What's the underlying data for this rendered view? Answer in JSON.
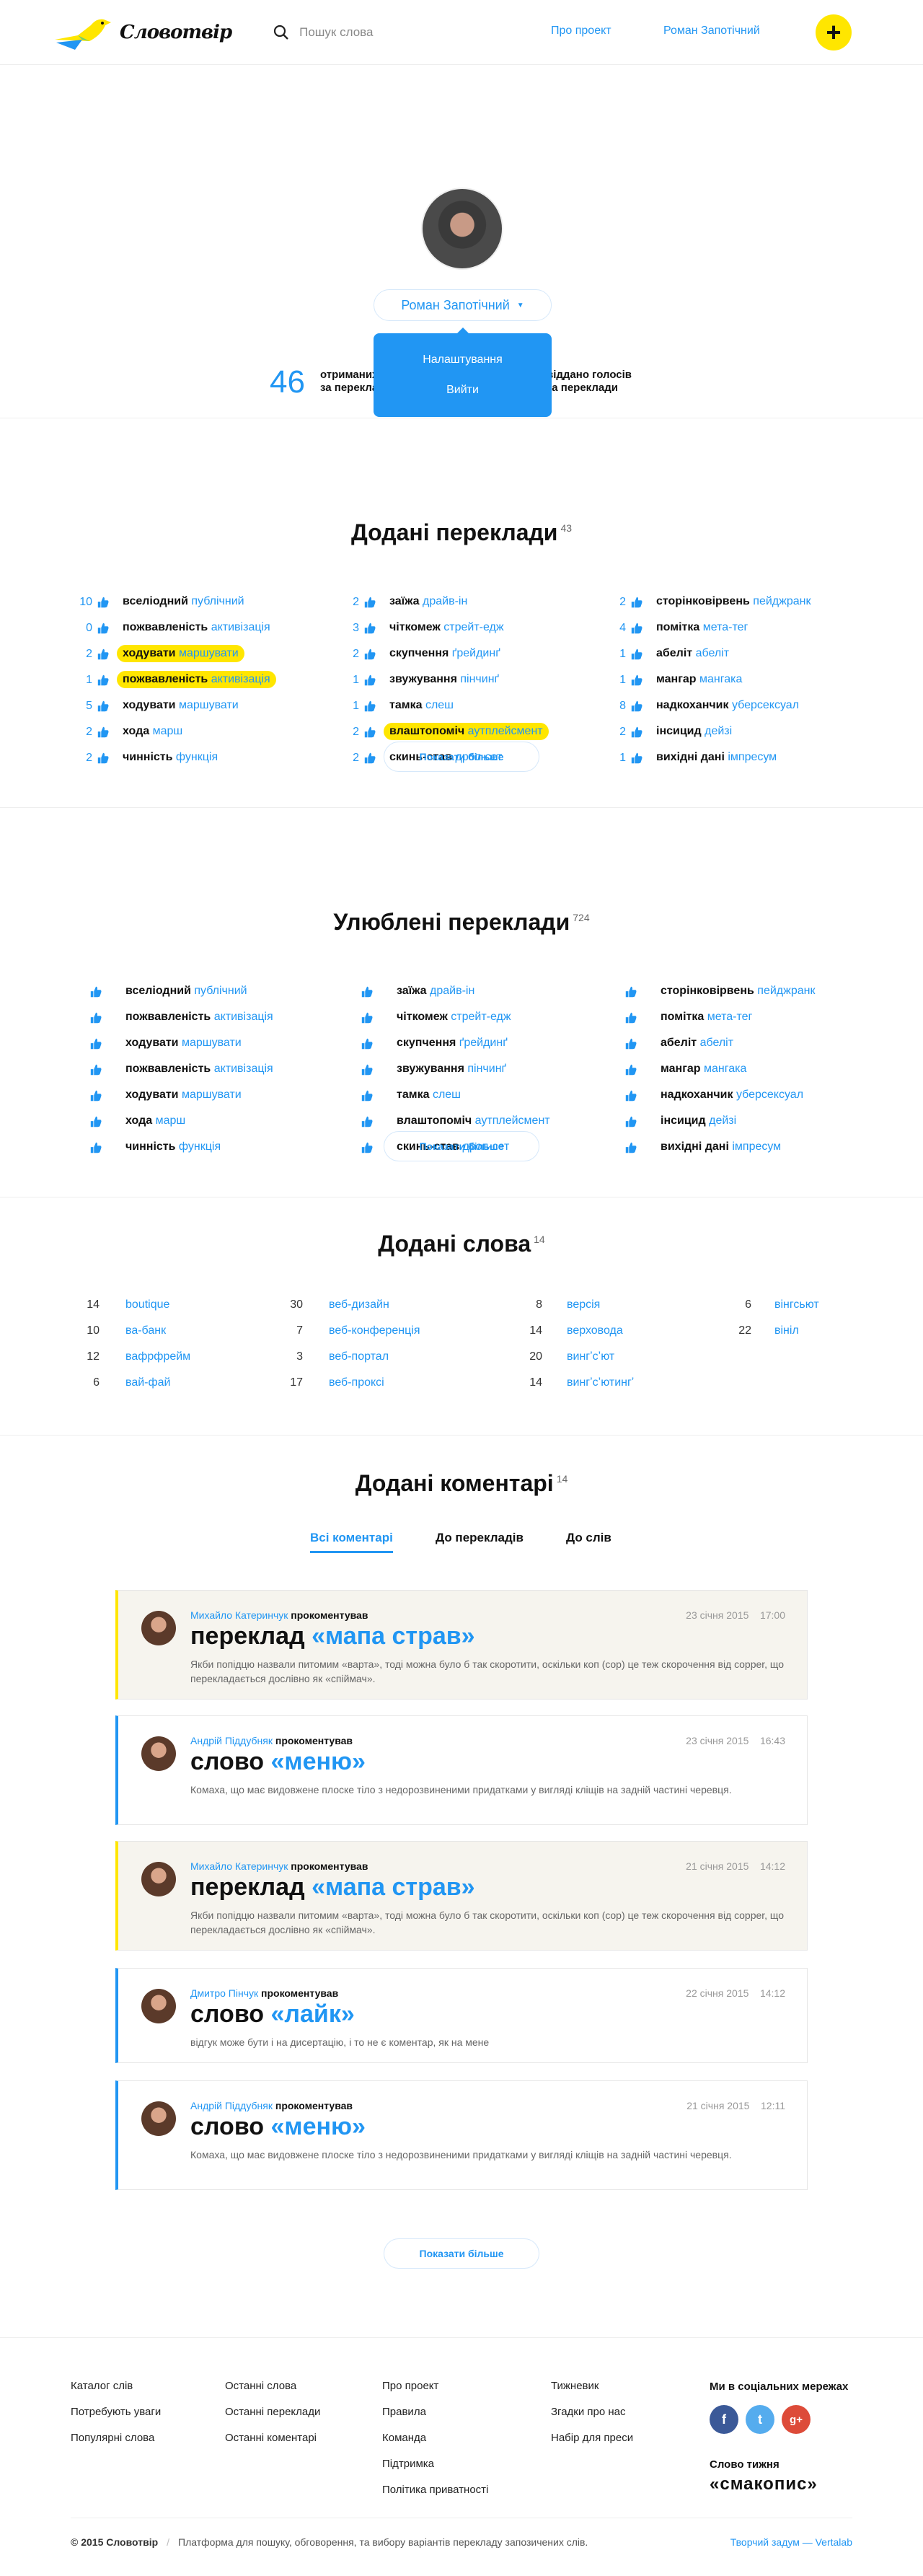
{
  "header": {
    "logo_text": "Словотвір",
    "search_placeholder": "Пошук слова",
    "nav": [
      "Про проект",
      "Роман Запотічний"
    ],
    "add_label": "+"
  },
  "profile": {
    "user_label": "Роман Запотічний",
    "menu": [
      "Налаштування",
      "Вийти"
    ],
    "stat1_num": "46",
    "stat1_lbl1": "отриманих голосів",
    "stat1_lbl2": "за переклади",
    "stat2_lbl1": "віддано голосів",
    "stat2_lbl2": "за переклади"
  },
  "added_translations": {
    "title": "Додані переклади",
    "count": "43",
    "more": "Показати більше",
    "cols": [
      [
        {
          "n": "10",
          "w": "вселіодний",
          "t": "публічний",
          "hl": false
        },
        {
          "n": "0",
          "w": "пожвавленість",
          "t": "активізація",
          "hl": false
        },
        {
          "n": "2",
          "w": "ходувати",
          "t": "маршувати",
          "hl": true
        },
        {
          "n": "1",
          "w": "пожвавленість",
          "t": "активізація",
          "hl": true
        },
        {
          "n": "5",
          "w": "ходувати",
          "t": "маршувати",
          "hl": false
        },
        {
          "n": "2",
          "w": "хода",
          "t": "марш",
          "hl": false
        },
        {
          "n": "2",
          "w": "чинність",
          "t": "функція",
          "hl": false
        }
      ],
      [
        {
          "n": "2",
          "w": "заїжа",
          "t": "драйв-ін",
          "hl": false
        },
        {
          "n": "3",
          "w": "чіткомеж",
          "t": "стрейт-едж",
          "hl": false
        },
        {
          "n": "2",
          "w": "скупчення",
          "t": "ґрейдинґ",
          "hl": false
        },
        {
          "n": "1",
          "w": "звужування",
          "t": "пінчинґ",
          "hl": false
        },
        {
          "n": "1",
          "w": "тамка",
          "t": "слеш",
          "hl": false
        },
        {
          "n": "2",
          "w": "влаштопоміч",
          "t": "аутплейсмент",
          "hl": true
        },
        {
          "n": "2",
          "w": "скинь-став",
          "t": "дроп-сет",
          "hl": false
        }
      ],
      [
        {
          "n": "2",
          "w": "сторінковірвень",
          "t": "пейджранк",
          "hl": false
        },
        {
          "n": "4",
          "w": "помітка",
          "t": "мета-тег",
          "hl": false
        },
        {
          "n": "1",
          "w": "абеліт",
          "t": "абеліт",
          "hl": false
        },
        {
          "n": "1",
          "w": "мангар",
          "t": "мангака",
          "hl": false
        },
        {
          "n": "8",
          "w": "надкоханчик",
          "t": "уберсексуал",
          "hl": false
        },
        {
          "n": "2",
          "w": "інсицид",
          "t": "дейзі",
          "hl": false
        },
        {
          "n": "1",
          "w": "вихідні дані",
          "t": "імпресум",
          "hl": false
        }
      ]
    ]
  },
  "favorite_translations": {
    "title": "Улюблені переклади",
    "count": "724",
    "more": "Показати більше",
    "cols": [
      [
        {
          "w": "вселіодний",
          "t": "публічний"
        },
        {
          "w": "пожвавленість",
          "t": "активізація"
        },
        {
          "w": "ходувати",
          "t": "маршувати"
        },
        {
          "w": "пожвавленість",
          "t": "активізація"
        },
        {
          "w": "ходувати",
          "t": "маршувати"
        },
        {
          "w": "хода",
          "t": "марш"
        },
        {
          "w": "чинність",
          "t": "функція"
        }
      ],
      [
        {
          "w": "заїжа",
          "t": "драйв-ін"
        },
        {
          "w": "чіткомеж",
          "t": "стрейт-едж"
        },
        {
          "w": "скупчення",
          "t": "ґрейдинґ"
        },
        {
          "w": "звужування",
          "t": "пінчинґ"
        },
        {
          "w": "тамка",
          "t": "слеш"
        },
        {
          "w": "влаштопоміч",
          "t": "аутплейсмент"
        },
        {
          "w": "скинь-став",
          "t": "дроп-сет"
        }
      ],
      [
        {
          "w": "сторінковірвень",
          "t": "пейджранк"
        },
        {
          "w": "помітка",
          "t": "мета-тег"
        },
        {
          "w": "абеліт",
          "t": "абеліт"
        },
        {
          "w": "мангар",
          "t": "мангака"
        },
        {
          "w": "надкоханчик",
          "t": "уберсексуал"
        },
        {
          "w": "інсицид",
          "t": "дейзі"
        },
        {
          "w": "вихідні дані",
          "t": "імпресум"
        }
      ]
    ]
  },
  "added_words": {
    "title": "Додані слова",
    "count": "14",
    "cols": [
      [
        {
          "n": "14",
          "w": "boutique"
        },
        {
          "n": "10",
          "w": "ва-банк"
        },
        {
          "n": "12",
          "w": "вафрфрейм"
        },
        {
          "n": "6",
          "w": "вай-фай"
        }
      ],
      [
        {
          "n": "30",
          "w": "веб-дизайн"
        },
        {
          "n": "7",
          "w": "веб-конференція"
        },
        {
          "n": "3",
          "w": "веб-портал"
        },
        {
          "n": "17",
          "w": "веб-проксі"
        }
      ],
      [
        {
          "n": "8",
          "w": "версія"
        },
        {
          "n": "14",
          "w": "верховода"
        },
        {
          "n": "20",
          "w": "вингʼсʼют"
        },
        {
          "n": "14",
          "w": "вингʼсʼютингʼ"
        }
      ],
      [
        {
          "n": "6",
          "w": "вінгсьют"
        },
        {
          "n": "22",
          "w": "вініл"
        }
      ]
    ]
  },
  "comments": {
    "title": "Додані коментарі",
    "count": "14",
    "tabs": [
      "Всі коментарі",
      "До перекладів",
      "До слів"
    ],
    "more": "Показати більше",
    "items": [
      {
        "author": "Михайло Катеринчук",
        "action": "прокоментував",
        "date": "23 січня 2015",
        "time": "17:00",
        "prefix": "переклад",
        "quote": "«мапа страв»",
        "text": "Якби попідцю назвали питомим «варта», тоді можна було б так скоротити, оскільки коп (cop) це теж скорочення від copper, що перекладається дослівно як «спіймач»."
      },
      {
        "author": "Андрій Піддубняк",
        "action": "прокоментував",
        "date": "23 січня 2015",
        "time": "16:43",
        "prefix": "слово",
        "quote": "«меню»",
        "text": "Комаха, що має видовжене плоске тіло з недорозвиненими придатками у вигляді кліщів на задній частині черевця."
      },
      {
        "author": "Михайло Катеринчук",
        "action": "прокоментував",
        "date": "21 січня 2015",
        "time": "14:12",
        "prefix": "переклад",
        "quote": "«мапа страв»",
        "text": "Якби попідцю назвали питомим «варта», тоді можна було б так скоротити, оскільки коп (cop) це теж скорочення від copper, що перекладається дослівно як «спіймач»."
      },
      {
        "author": "Дмитро Пінчук",
        "action": "прокоментував",
        "date": "22 січня 2015",
        "time": "14:12",
        "prefix": "слово",
        "quote": "«лайк»",
        "text": "відгук може бути і на дисертацію, і то не є коментар, як на мене"
      },
      {
        "author": "Андрій Піддубняк",
        "action": "прокоментував",
        "date": "21 січня 2015",
        "time": "12:11",
        "prefix": "слово",
        "quote": "«меню»",
        "text": "Комаха, що має видовжене плоске тіло з недорозвиненими придатками у вигляді кліщів на задній частині черевця."
      }
    ]
  },
  "footer": {
    "col1": [
      "Каталог слів",
      "Потребують уваги",
      "Популярні слова"
    ],
    "col2": [
      "Останні слова",
      "Останні переклади",
      "Останні коментарі"
    ],
    "col3": [
      "Про проект",
      "Правила",
      "Команда",
      "Підтримка",
      "Політика приватності"
    ],
    "col4": [
      "Тижневик",
      "Згадки про нас",
      "Набір для преси"
    ],
    "social_title": "Ми в соціальних мережах",
    "social": [
      "f",
      "t",
      "g+"
    ],
    "word_week_label": "Слово тижня",
    "word_week": "«смакопис»",
    "copyright": "© 2015 Словотвір",
    "tagline": "Платформа для пошуку, обговорення, та вибору варіантів перекладу запозичених слів.",
    "madeby": "Творчий задум — Vertalab"
  },
  "colors": {
    "accent": "#2196f3",
    "highlight": "#ffe600",
    "beige": "#f6f4ee"
  }
}
